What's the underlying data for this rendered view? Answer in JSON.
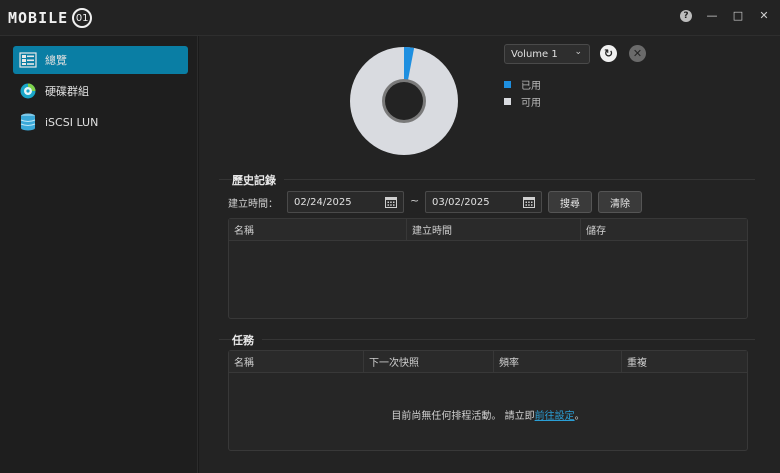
{
  "app": {
    "logo_text": "MOBILE",
    "logo_badge": "01"
  },
  "titlebar": {
    "help": "?",
    "minimize": "—",
    "maximize": "□",
    "close": "✕"
  },
  "sidebar": {
    "items": [
      {
        "label": "總覽",
        "icon": "overview-icon",
        "active": true
      },
      {
        "label": "硬碟群組",
        "icon": "disk-group-icon",
        "active": false
      },
      {
        "label": "iSCSI LUN",
        "icon": "database-icon",
        "active": false
      }
    ]
  },
  "volume": {
    "selected": "Volume 1",
    "used_fraction": 0.03,
    "colors": {
      "used": "#1e8fe0",
      "available": "#d9dbe0"
    },
    "legend": {
      "used": "已用",
      "available": "可用"
    }
  },
  "history": {
    "title": "歷史記錄",
    "date_label": "建立時間：",
    "start_date": "02/24/2025",
    "separator": "~",
    "end_date": "03/02/2025",
    "search_label": "搜尋",
    "clear_label": "清除",
    "columns": [
      "名稱",
      "建立時間",
      "儲存"
    ]
  },
  "tasks": {
    "title": "任務",
    "columns": [
      "名稱",
      "下一次快照",
      "頻率",
      "重複"
    ],
    "empty_message": "目前尚無任何排程活動。 請立即",
    "empty_link": "前往設定",
    "empty_suffix": "。"
  }
}
